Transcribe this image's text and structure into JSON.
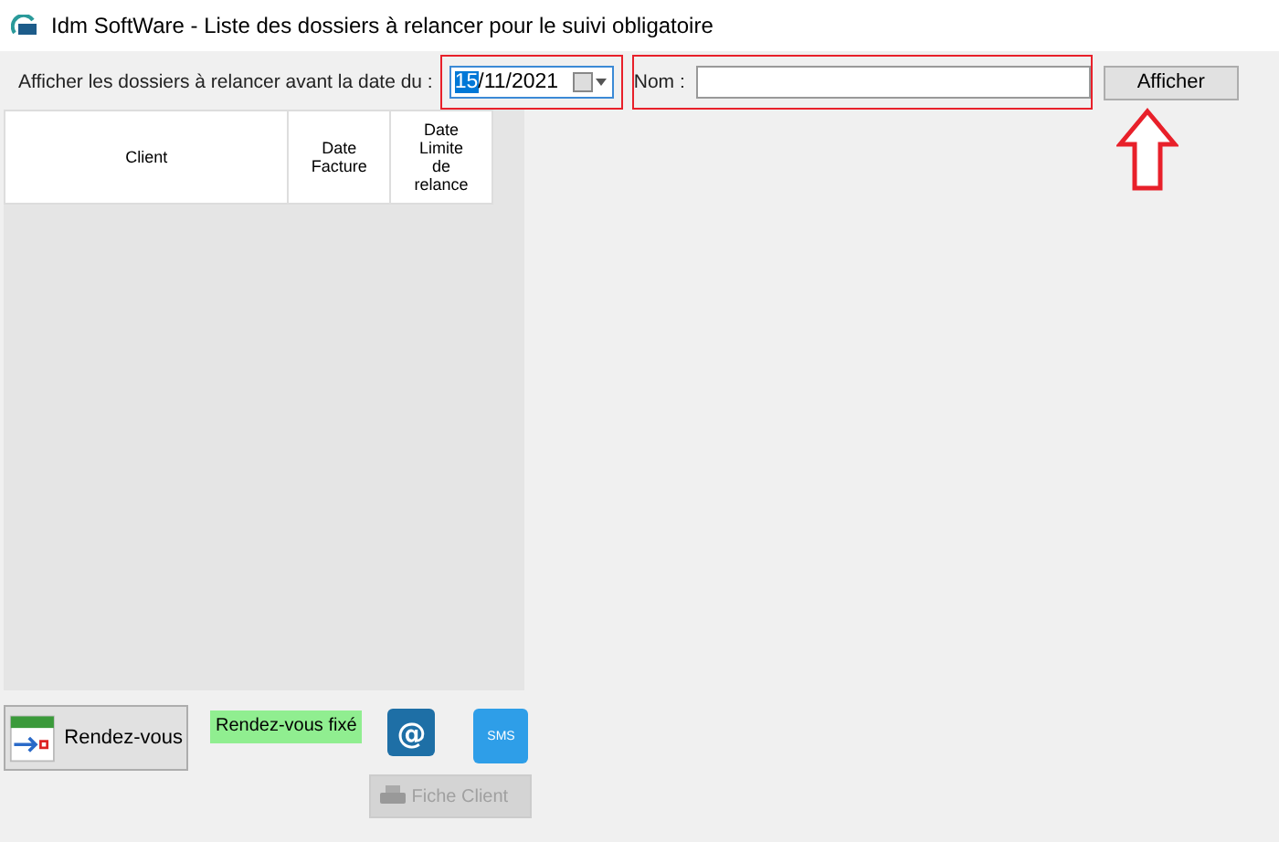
{
  "window": {
    "title": "Idm SoftWare - Liste des dossiers à relancer pour le suivi obligatoire"
  },
  "filter": {
    "date_label": "Afficher les dossiers à relancer avant la date du :",
    "date_selected_part": "15",
    "date_rest": "/11/2021",
    "name_label": "Nom :",
    "search_button": "Afficher"
  },
  "table": {
    "columns": [
      "Client",
      "Date Facture",
      "Date Limite de relance"
    ]
  },
  "actions": {
    "appointment_button": "Rendez-vous",
    "appointment_status": "Rendez-vous fixé",
    "email_button": "@",
    "sms_button": "SMS",
    "client_button": {
      "label": "Fiche Client",
      "disabled": true
    }
  }
}
